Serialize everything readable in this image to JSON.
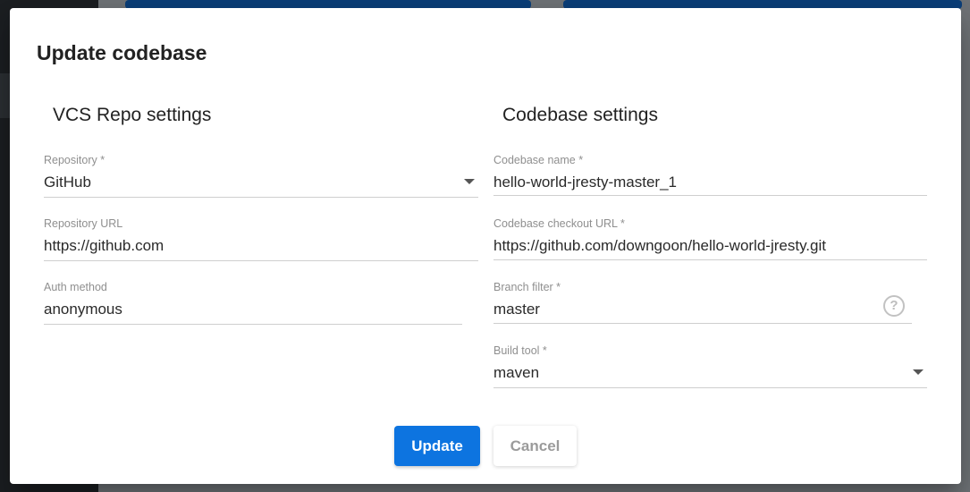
{
  "dialog": {
    "title": "Update codebase",
    "vcs_section_title": "VCS Repo settings",
    "codebase_section_title": "Codebase settings"
  },
  "vcs": {
    "repository": {
      "label": "Repository *",
      "value": "GitHub"
    },
    "repository_url": {
      "label": "Repository URL",
      "value": "https://github.com"
    },
    "auth_method": {
      "label": "Auth method",
      "value": "anonymous"
    }
  },
  "codebase": {
    "name": {
      "label": "Codebase name *",
      "value": "hello-world-jresty-master_1"
    },
    "checkout_url": {
      "label": "Codebase checkout URL *",
      "value": "https://github.com/downgoon/hello-world-jresty.git"
    },
    "branch_filter": {
      "label": "Branch filter *",
      "value": "master"
    },
    "build_tool": {
      "label": "Build tool *",
      "value": "maven"
    }
  },
  "buttons": {
    "update": "Update",
    "cancel": "Cancel"
  },
  "icons": {
    "dropdown": "chevron-down-icon",
    "help": "help-circle-icon"
  },
  "colors": {
    "primary": "#0d74e0"
  }
}
